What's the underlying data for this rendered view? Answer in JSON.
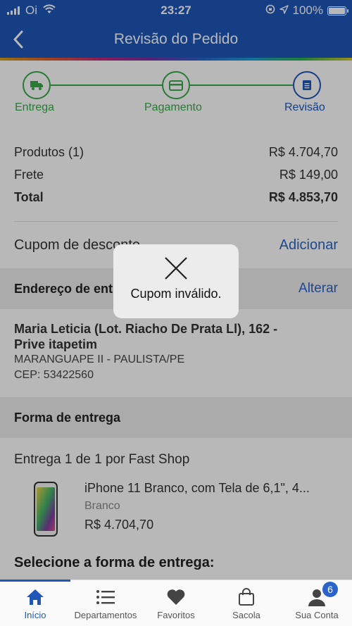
{
  "status_bar": {
    "carrier": "Oi",
    "time": "23:27",
    "battery": "100%"
  },
  "nav": {
    "title": "Revisão do Pedido"
  },
  "stepper": {
    "steps": [
      {
        "label": "Entrega",
        "icon": "truck-icon",
        "state": "done"
      },
      {
        "label": "Pagamento",
        "icon": "card-icon",
        "state": "done"
      },
      {
        "label": "Revisão",
        "icon": "document-icon",
        "state": "active"
      }
    ]
  },
  "summary": {
    "products_label": "Produtos (1)",
    "products_value": "R$ 4.704,70",
    "shipping_label": "Frete",
    "shipping_value": "R$ 149,00",
    "total_label": "Total",
    "total_value": "R$ 4.853,70"
  },
  "coupon": {
    "label": "Cupom de desconto",
    "action": "Adicionar"
  },
  "address_section": {
    "title": "Endereço de entrega",
    "action": "Alterar",
    "line1": "Maria Leticia (Lot. Riacho De Prata Ll), 162 -",
    "line2": "Prive itapetim",
    "line3": "MARANGUAPE II - PAULISTA/PE",
    "line4": "CEP: 53422560"
  },
  "delivery_section": {
    "title": "Forma de entrega",
    "delivery_count": "Entrega 1 de 1",
    "by_label": "por Fast Shop",
    "select_title": "Selecione a forma de entrega:"
  },
  "product": {
    "name": "iPhone 11 Branco, com Tela de 6,1\", 4...",
    "variant": "Branco",
    "price": "R$ 4.704,70"
  },
  "toast": {
    "message": "Cupom inválido."
  },
  "tabbar": {
    "tabs": [
      {
        "label": "Início",
        "icon": "home-icon"
      },
      {
        "label": "Departamentos",
        "icon": "list-icon"
      },
      {
        "label": "Favoritos",
        "icon": "heart-icon"
      },
      {
        "label": "Sacola",
        "icon": "bag-icon"
      },
      {
        "label": "Sua Conta",
        "icon": "user-icon"
      }
    ],
    "account_badge": "6"
  },
  "colors": {
    "brand_blue": "#1f56b7",
    "step_green": "#3aa94a",
    "link_blue": "#2a63c9"
  }
}
